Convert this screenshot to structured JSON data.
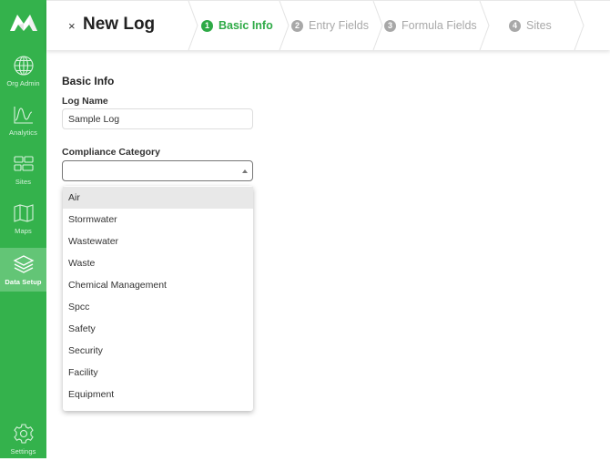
{
  "app": {
    "brand_color": "#34b24c",
    "active_nav_color": "#63c576",
    "step_active_color": "#2eaa46",
    "step_inactive_color": "#a8a8a8"
  },
  "sidebar": {
    "logo_icon": "mountain-logo-icon",
    "items": [
      {
        "label": "Org Admin",
        "icon": "globe-icon",
        "active": false
      },
      {
        "label": "Analytics",
        "icon": "chart-line-icon",
        "active": false
      },
      {
        "label": "Sites",
        "icon": "grid-icon",
        "active": false
      },
      {
        "label": "Maps",
        "icon": "map-icon",
        "active": false
      },
      {
        "label": "Data Setup",
        "icon": "layers-icon",
        "active": true
      }
    ],
    "settings": {
      "label": "Settings",
      "icon": "gear-icon"
    }
  },
  "header": {
    "close_label": "×",
    "title": "New Log",
    "steps": [
      {
        "number": "1",
        "label": "Basic Info",
        "active": true
      },
      {
        "number": "2",
        "label": "Entry Fields",
        "active": false
      },
      {
        "number": "3",
        "label": "Formula Fields",
        "active": false
      },
      {
        "number": "4",
        "label": "Sites",
        "active": false
      }
    ]
  },
  "form": {
    "section_title": "Basic Info",
    "log_name": {
      "label": "Log Name",
      "value": "Sample Log"
    },
    "compliance_category": {
      "label": "Compliance Category",
      "value": "",
      "open": true,
      "highlighted": "Air",
      "options": [
        "Air",
        "Stormwater",
        "Wastewater",
        "Waste",
        "Chemical Management",
        "Spcc",
        "Safety",
        "Security",
        "Facility",
        "Equipment"
      ]
    }
  }
}
